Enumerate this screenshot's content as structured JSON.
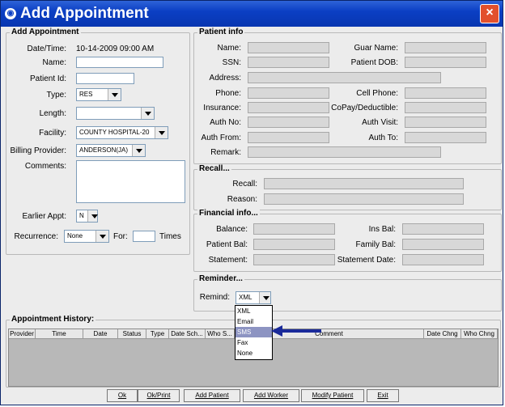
{
  "window": {
    "title": "Add Appointment",
    "icon": "eye-icon",
    "close": "×"
  },
  "appointment": {
    "group_title": "Add Appointment",
    "datetime_label": "Date/Time:",
    "datetime_value": "10-14-2009 09:00 AM",
    "name_label": "Name:",
    "patient_id_label": "Patient Id:",
    "type_label": "Type:",
    "type_value": "RES",
    "length_label": "Length:",
    "length_value": "",
    "facility_label": "Facility:",
    "facility_value": "COUNTY HOSPITAL-20",
    "billing_label": "Billing Provider:",
    "billing_value": "ANDERSON(JA)",
    "comments_label": "Comments:",
    "earlier_label": "Earlier Appt:",
    "earlier_value": "N",
    "recurrence_label": "Recurrence:",
    "recurrence_value": "None",
    "for_label": "For:",
    "times_label": "Times"
  },
  "patient_info": {
    "group_title": "Patient info",
    "name": "Name:",
    "guar_name": "Guar Name:",
    "ssn": "SSN:",
    "dob": "Patient DOB:",
    "address": "Address:",
    "phone": "Phone:",
    "cell": "Cell Phone:",
    "insurance": "Insurance:",
    "copay": "CoPay/Deductible:",
    "auth_no": "Auth No:",
    "auth_visit": "Auth Visit:",
    "auth_from": "Auth From:",
    "auth_to": "Auth To:",
    "remark": "Remark:"
  },
  "recall": {
    "group_title": "Recall...",
    "recall": "Recall:",
    "reason": "Reason:"
  },
  "financial": {
    "group_title": "Financial info...",
    "balance": "Balance:",
    "ins_bal": "Ins Bal:",
    "patient_bal": "Patient Bal:",
    "family_bal": "Family Bal:",
    "statement": "Statement:",
    "statement_date": "Statement Date:"
  },
  "reminder": {
    "group_title": "Reminder...",
    "remind_label": "Remind:",
    "remind_value": "XML",
    "options": [
      "XML",
      "Email",
      "SMS",
      "Fax",
      "None"
    ],
    "selected": "SMS"
  },
  "history": {
    "group_title": "Appointment History:",
    "columns": [
      "Provider",
      "Time",
      "Date",
      "Status",
      "Type",
      "Date Sch...",
      "Who S...",
      "Comment",
      "Date Chng",
      "Who Chng"
    ]
  },
  "buttons": {
    "ok": "Ok",
    "ok_print": "Ok/Print",
    "add_patient": "Add Patient",
    "add_worker": "Add Worker",
    "modify_patient": "Modify Patient",
    "exit": "Exit"
  },
  "colors": {
    "titlebar": "#0b3fc4",
    "arrow": "#1a2a9a",
    "selection": "#8d94c2"
  }
}
